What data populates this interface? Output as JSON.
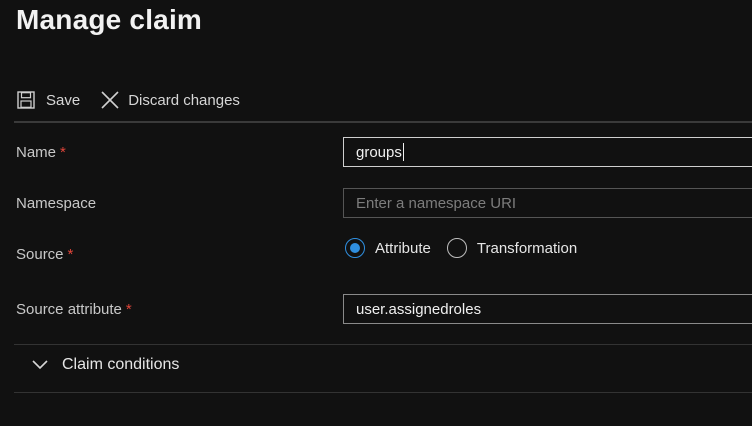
{
  "page": {
    "title": "Manage claim"
  },
  "toolbar": {
    "save_label": "Save",
    "discard_label": "Discard changes"
  },
  "form": {
    "name": {
      "label": "Name",
      "required_mark": "*",
      "value": "groups"
    },
    "namespace": {
      "label": "Namespace",
      "placeholder": "Enter a namespace URI",
      "value": ""
    },
    "source": {
      "label": "Source",
      "required_mark": "*",
      "options": [
        {
          "label": "Attribute",
          "selected": true
        },
        {
          "label": "Transformation",
          "selected": false
        }
      ]
    },
    "source_attribute": {
      "label": "Source attribute",
      "required_mark": "*",
      "value": "user.assignedroles"
    }
  },
  "sections": {
    "claim_conditions": {
      "label": "Claim conditions",
      "expanded": false
    }
  },
  "colors": {
    "accent": "#2f8fe0",
    "required": "#e0453a",
    "background": "#111111"
  }
}
